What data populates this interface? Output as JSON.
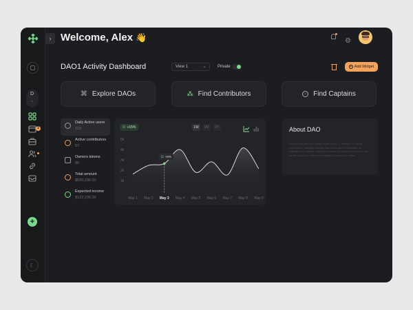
{
  "header": {
    "welcome": "Welcome, Alex",
    "emoji": "👋"
  },
  "toolbar": {
    "title": "DAO1 Activity Dashboard",
    "view_select": "View 1",
    "private_label": "Private",
    "add_widget": "Add Widget"
  },
  "sidebar": {
    "workspace_letter": "D",
    "badge_count": "2"
  },
  "quick_actions": [
    {
      "label": "Explore DAOs",
      "icon": "command-icon"
    },
    {
      "label": "Find Contributors",
      "icon": "people-icon"
    },
    {
      "label": "Find Captains",
      "icon": "captain-icon"
    }
  ],
  "stats": [
    {
      "label": "Daily Active users",
      "value": "122"
    },
    {
      "label": "Active contributors",
      "value": "57"
    },
    {
      "label": "Owners  tokens",
      "value": "90"
    },
    {
      "label": "Total amount",
      "value": "$500,236.00"
    },
    {
      "label": "Expected income",
      "value": "$122,236.00"
    }
  ],
  "chart_panel": {
    "change_badge": "+15%",
    "range_tabs": [
      "1W",
      "1M",
      "1Y"
    ],
    "active_range": "1W",
    "point_badge": "+5%"
  },
  "chart_data": {
    "type": "area",
    "categories": [
      "May 1",
      "May 2",
      "May 3",
      "May 4",
      "May 5",
      "May 6",
      "May 7",
      "May 8",
      "May 9"
    ],
    "y_ticks": [
      "6k",
      "4k",
      "3k",
      "2k",
      "1k"
    ],
    "series": [
      {
        "values": [
          2.0,
          3.0,
          3.2,
          4.8,
          2.2,
          3.4,
          1.9,
          5.0,
          2.6
        ]
      }
    ],
    "highlight_index": 2,
    "ylim": [
      0,
      6
    ]
  },
  "about": {
    "title": "About DAO",
    "text": "I live in any user-first driven experience — whether it's initial exploration, critically refining user flows and functionality, or polishing the visuals. I help businesses develop their product and iterate quickly to deliver meaningful, successful media."
  },
  "colors": {
    "accent": "#7ad98a",
    "orange": "#f5a25d",
    "bg": "#1c1d20",
    "panel": "#232427"
  }
}
